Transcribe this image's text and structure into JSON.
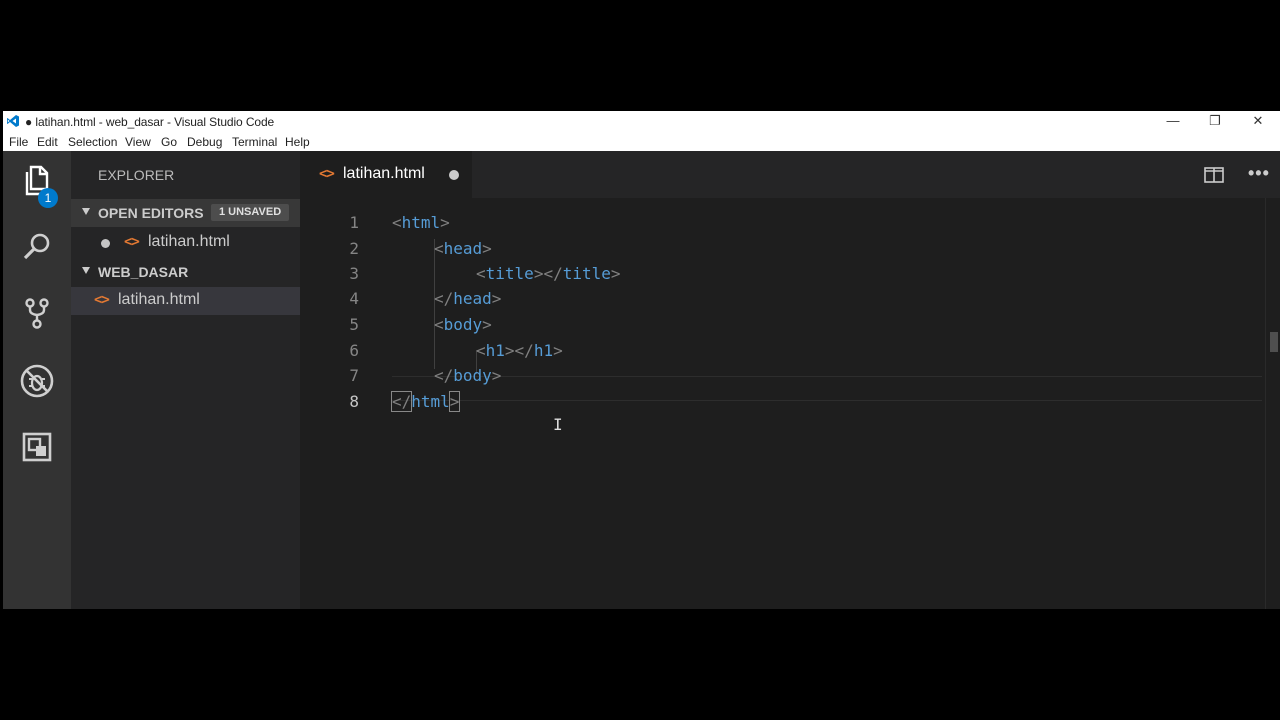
{
  "window": {
    "title": "● latihan.html - web_dasar - Visual Studio Code",
    "controls": {
      "minimize": "—",
      "restore": "❐",
      "close": "✕"
    }
  },
  "menu": [
    "File",
    "Edit",
    "Selection",
    "View",
    "Go",
    "Debug",
    "Terminal",
    "Help"
  ],
  "activity_bar": {
    "items": [
      "explorer-icon",
      "search-icon",
      "source-control-icon",
      "debug-icon",
      "extensions-icon"
    ],
    "explorer_badge": "1"
  },
  "sidebar": {
    "header": "EXPLORER",
    "open_editors": {
      "label": "OPEN EDITORS",
      "badge": "1 UNSAVED",
      "files": [
        "latihan.html"
      ]
    },
    "folder": {
      "label": "WEB_DASAR",
      "files": [
        "latihan.html"
      ]
    }
  },
  "editor": {
    "tab": {
      "label": "latihan.html",
      "dirty": true
    },
    "actions": {
      "split": "split-editor-icon",
      "more": "•••"
    },
    "line_numbers": [
      "1",
      "2",
      "3",
      "4",
      "5",
      "6",
      "7",
      "8"
    ],
    "current_line": "8",
    "lines": [
      {
        "open": "<",
        "tag": "html",
        "close": ">"
      },
      {
        "open": "<",
        "tag": "head",
        "close": ">"
      },
      {
        "open": "<",
        "tag": "title",
        "close": "></",
        "tag2": "title",
        "close2": ">"
      },
      {
        "open": "</",
        "tag": "head",
        "close": ">"
      },
      {
        "open": "<",
        "tag": "body",
        "close": ">"
      },
      {
        "open": "<",
        "tag": "h1",
        "close": "></",
        "tag2": "h1",
        "close2": ">"
      },
      {
        "open": "</",
        "tag": "body",
        "close": ">"
      },
      {
        "open": "</",
        "tag": "html",
        "close": ">"
      }
    ]
  },
  "colors": {
    "accent": "#007acc",
    "file_icon": "#e37933",
    "tag": "#569cd6",
    "bracket": "#808080"
  }
}
